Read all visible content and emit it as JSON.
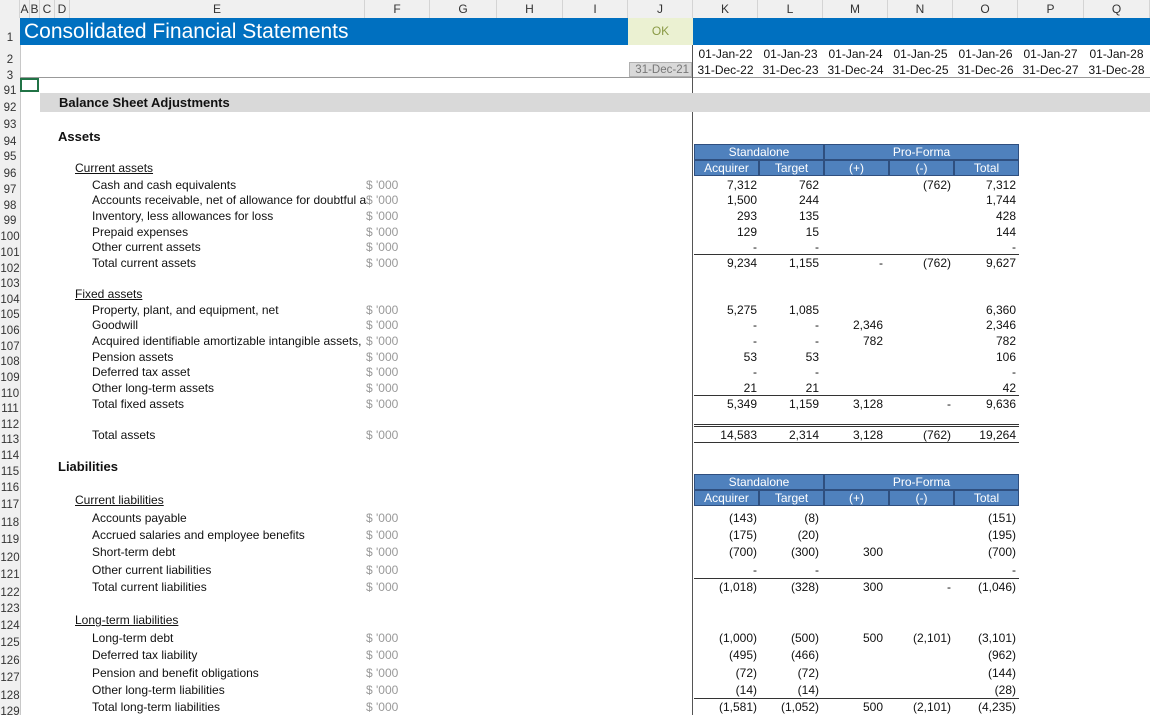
{
  "columns": [
    "A",
    "B",
    "C",
    "D",
    "E",
    "F",
    "G",
    "H",
    "I",
    "J",
    "K",
    "L",
    "M",
    "N",
    "O",
    "P",
    "Q"
  ],
  "title": "Consolidated Financial Statements",
  "check": "OK",
  "period_start": [
    "01-Jan-22",
    "01-Jan-23",
    "01-Jan-24",
    "01-Jan-25",
    "01-Jan-26",
    "01-Jan-27",
    "01-Jan-28"
  ],
  "period_end": [
    "31-Dec-22",
    "31-Dec-23",
    "31-Dec-24",
    "31-Dec-25",
    "31-Dec-26",
    "31-Dec-27",
    "31-Dec-28"
  ],
  "prior_date": "31-Dec-21",
  "section": "Balance Sheet Adjustments",
  "assets_heading": "Assets",
  "liabilities_heading": "Liabilities",
  "table_headers": {
    "standalone": "Standalone",
    "proforma": "Pro-Forma",
    "acquirer": "Acquirer",
    "target": "Target",
    "plus": "(+)",
    "minus": "(-)",
    "total": "Total"
  },
  "unit": "$ '000",
  "row_numbers": [
    "1",
    "2",
    "3",
    "91",
    "92",
    "93",
    "94",
    "95",
    "96",
    "97",
    "98",
    "99",
    "100",
    "101",
    "102",
    "103",
    "104",
    "105",
    "106",
    "107",
    "108",
    "109",
    "110",
    "111",
    "112",
    "113",
    "114",
    "115",
    "116",
    "117",
    "118",
    "119",
    "120",
    "121",
    "122",
    "123",
    "124",
    "125",
    "126",
    "127",
    "128",
    "129"
  ],
  "asset_groups": {
    "current": "Current assets",
    "fixed": "Fixed assets",
    "current_liab": "Current liabilities",
    "longterm_liab": "Long-term liabilities"
  },
  "asset_rows": [
    {
      "label": "Cash and cash equivalents",
      "acq": "7,312",
      "tgt": "762",
      "plus": "",
      "minus": "(762)",
      "total": "7,312"
    },
    {
      "label": "Accounts receivable, net of allowance for doubtful a",
      "acq": "1,500",
      "tgt": "244",
      "plus": "",
      "minus": "",
      "total": "1,744"
    },
    {
      "label": "Inventory, less allowances for loss",
      "acq": "293",
      "tgt": "135",
      "plus": "",
      "minus": "",
      "total": "428"
    },
    {
      "label": "Prepaid expenses",
      "acq": "129",
      "tgt": "15",
      "plus": "",
      "minus": "",
      "total": "144"
    },
    {
      "label": "Other current assets",
      "acq": "-",
      "tgt": "-",
      "plus": "",
      "minus": "",
      "total": "-"
    },
    {
      "label": "Total current assets",
      "acq": "9,234",
      "tgt": "1,155",
      "plus": "-",
      "minus": "(762)",
      "total": "9,627"
    },
    {
      "label": "Property, plant, and equipment, net",
      "acq": "5,275",
      "tgt": "1,085",
      "plus": "",
      "minus": "",
      "total": "6,360"
    },
    {
      "label": "Goodwill",
      "acq": "-",
      "tgt": "-",
      "plus": "2,346",
      "minus": "",
      "total": "2,346"
    },
    {
      "label": "Acquired identifiable amortizable intangible assets,",
      "acq": "-",
      "tgt": "-",
      "plus": "782",
      "minus": "",
      "total": "782"
    },
    {
      "label": "Pension assets",
      "acq": "53",
      "tgt": "53",
      "plus": "",
      "minus": "",
      "total": "106"
    },
    {
      "label": "Deferred tax asset",
      "acq": "-",
      "tgt": "-",
      "plus": "",
      "minus": "",
      "total": "-"
    },
    {
      "label": "Other long-term assets",
      "acq": "21",
      "tgt": "21",
      "plus": "",
      "minus": "",
      "total": "42"
    },
    {
      "label": "Total fixed assets",
      "acq": "5,349",
      "tgt": "1,159",
      "plus": "3,128",
      "minus": "-",
      "total": "9,636"
    },
    {
      "label": "Total assets",
      "acq": "14,583",
      "tgt": "2,314",
      "plus": "3,128",
      "minus": "(762)",
      "total": "19,264"
    }
  ],
  "liab_rows": [
    {
      "label": "Accounts payable",
      "acq": "(143)",
      "tgt": "(8)",
      "plus": "",
      "minus": "",
      "total": "(151)"
    },
    {
      "label": "Accrued salaries and employee benefits",
      "acq": "(175)",
      "tgt": "(20)",
      "plus": "",
      "minus": "",
      "total": "(195)"
    },
    {
      "label": "Short-term debt",
      "acq": "(700)",
      "tgt": "(300)",
      "plus": "300",
      "minus": "",
      "total": "(700)"
    },
    {
      "label": "Other current liabilities",
      "acq": "-",
      "tgt": "-",
      "plus": "",
      "minus": "",
      "total": "-"
    },
    {
      "label": "Total current liabilities",
      "acq": "(1,018)",
      "tgt": "(328)",
      "plus": "300",
      "minus": "-",
      "total": "(1,046)"
    },
    {
      "label": "Long-term debt",
      "acq": "(1,000)",
      "tgt": "(500)",
      "plus": "500",
      "minus": "(2,101)",
      "total": "(3,101)"
    },
    {
      "label": "Deferred tax liability",
      "acq": "(495)",
      "tgt": "(466)",
      "plus": "",
      "minus": "",
      "total": "(962)"
    },
    {
      "label": "Pension and benefit obligations",
      "acq": "(72)",
      "tgt": "(72)",
      "plus": "",
      "minus": "",
      "total": "(144)"
    },
    {
      "label": "Other long-term liabilities",
      "acq": "(14)",
      "tgt": "(14)",
      "plus": "",
      "minus": "",
      "total": "(28)"
    },
    {
      "label": "Total long-term liabilities",
      "acq": "(1,581)",
      "tgt": "(1,052)",
      "plus": "500",
      "minus": "(2,101)",
      "total": "(4,235)"
    }
  ]
}
